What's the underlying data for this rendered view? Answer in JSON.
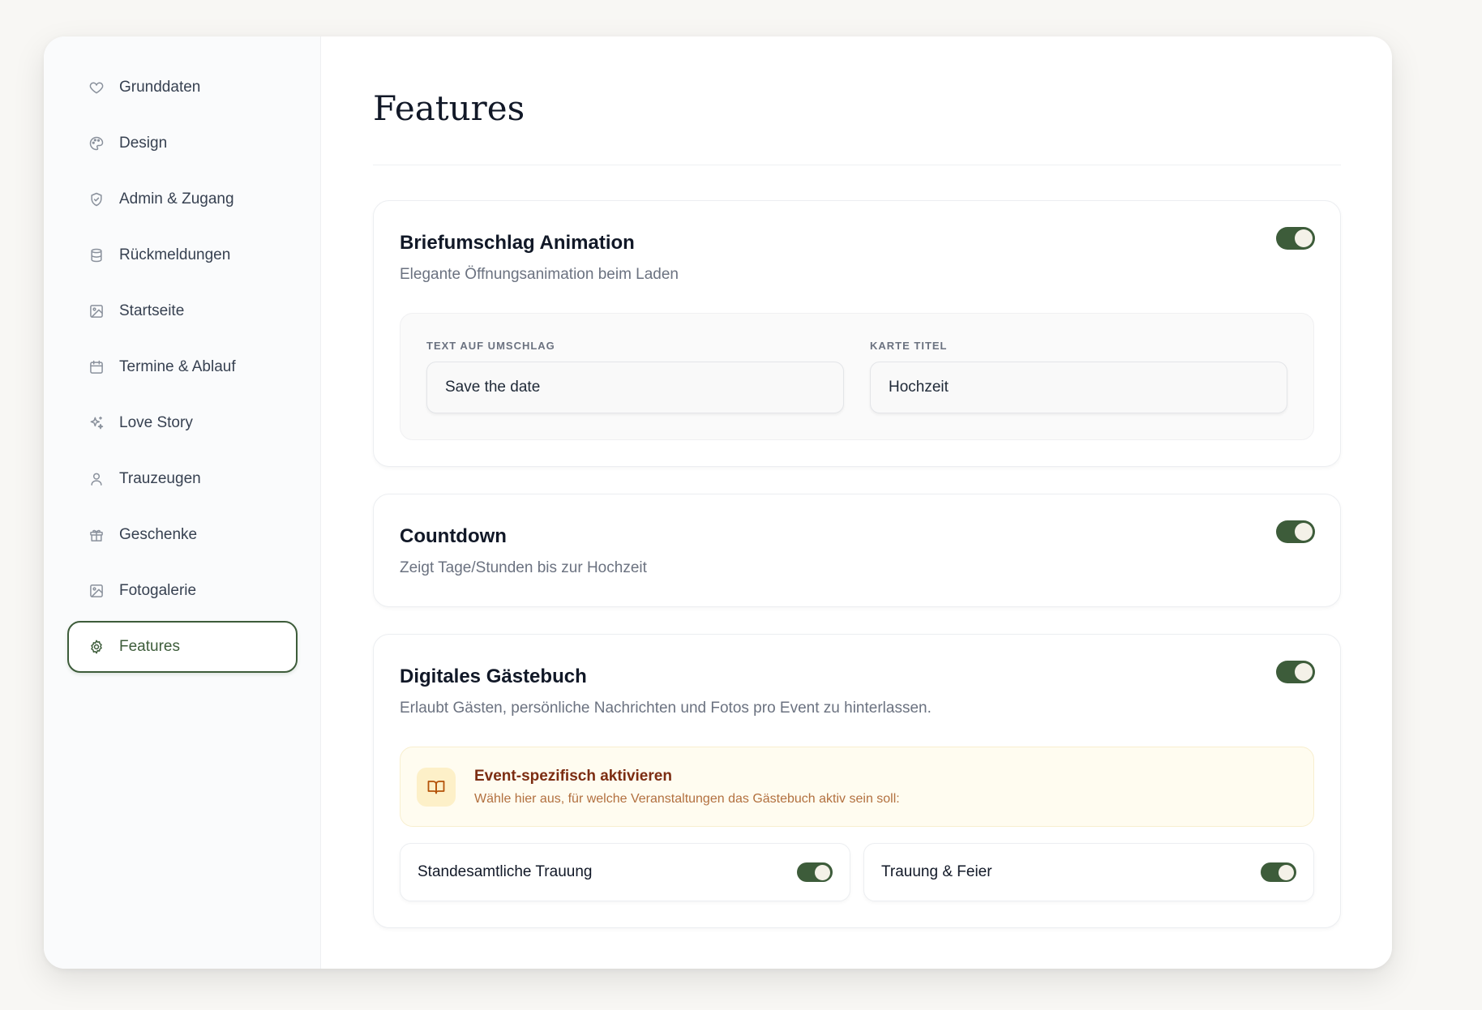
{
  "sidebar": {
    "items": [
      {
        "label": "Grunddaten",
        "icon": "heart-icon"
      },
      {
        "label": "Design",
        "icon": "palette-icon"
      },
      {
        "label": "Admin & Zugang",
        "icon": "shield-icon"
      },
      {
        "label": "Rückmeldungen",
        "icon": "database-icon"
      },
      {
        "label": "Startseite",
        "icon": "image-icon"
      },
      {
        "label": "Termine & Ablauf",
        "icon": "calendar-icon"
      },
      {
        "label": "Love Story",
        "icon": "sparkles-icon"
      },
      {
        "label": "Trauzeugen",
        "icon": "user-icon"
      },
      {
        "label": "Geschenke",
        "icon": "gift-icon"
      },
      {
        "label": "Fotogalerie",
        "icon": "image-icon"
      },
      {
        "label": "Features",
        "icon": "gear-icon",
        "active": true
      }
    ]
  },
  "main": {
    "title": "Features",
    "envelope": {
      "title": "Briefumschlag Animation",
      "description": "Elegante Öffnungsanimation beim Laden",
      "enabled": true,
      "fields": [
        {
          "label": "TEXT AUF UMSCHLAG",
          "value": "Save the date"
        },
        {
          "label": "KARTE TITEL",
          "value": "Hochzeit"
        }
      ]
    },
    "countdown": {
      "title": "Countdown",
      "description": "Zeigt Tage/Stunden bis zur Hochzeit",
      "enabled": true
    },
    "guestbook": {
      "title": "Digitales Gästebuch",
      "description": "Erlaubt Gästen, persönliche Nachrichten und Fotos pro Event zu hinterlassen.",
      "enabled": true,
      "info": {
        "title": "Event-spezifisch aktivieren",
        "subtitle": "Wähle hier aus, für welche Veranstaltungen das Gästebuch aktiv sein soll:",
        "icon": "book-open-icon"
      },
      "events": [
        {
          "label": "Standesamtliche Trauung",
          "enabled": true
        },
        {
          "label": "Trauung & Feier",
          "enabled": true
        }
      ]
    }
  },
  "colors": {
    "accent": "#3d5c3a",
    "toggle_knob": "#f4f1e8",
    "info_bg": "#fffcf0",
    "info_title": "#7c2d12"
  }
}
